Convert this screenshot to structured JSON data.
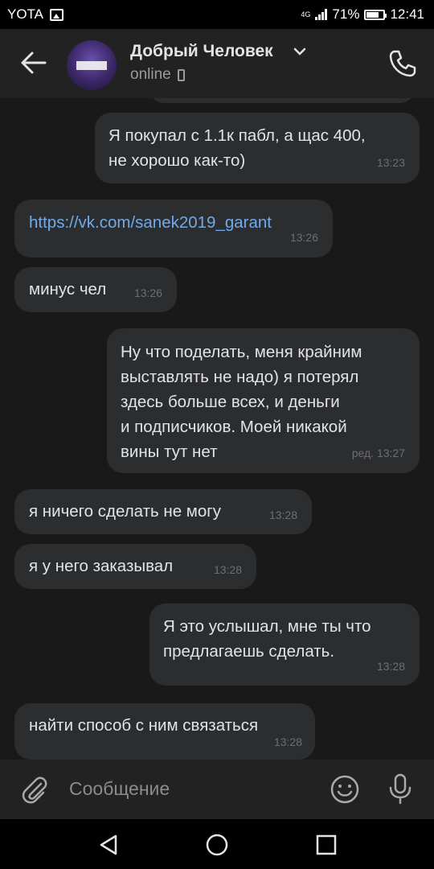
{
  "status_bar": {
    "carrier": "YOTA",
    "network": "4G",
    "battery": "71%",
    "time": "12:41"
  },
  "header": {
    "contact_name": "Добрый Человек",
    "presence": "online"
  },
  "messages": [
    {
      "direction": "out",
      "lines": [
        "Я покупал с 1.1к пабл, а щас 400,",
        "не хорошо как-то)"
      ],
      "time": "13:23"
    },
    {
      "direction": "in",
      "lines": [
        "https://vk.com/sanek2019_garant"
      ],
      "time": "13:26",
      "is_link": true
    },
    {
      "direction": "in",
      "lines": [
        "минус чел"
      ],
      "time": "13:26"
    },
    {
      "direction": "out",
      "lines": [
        "Ну что поделать, меня крайним",
        "выставлять не надо) я потерял",
        "здесь больше всех, и деньги",
        "и подписчиков. Моей никакой",
        "вины тут нет"
      ],
      "time": "ред. 13:27"
    },
    {
      "direction": "in",
      "lines": [
        "я ничего сделать не могу"
      ],
      "time": "13:28"
    },
    {
      "direction": "in",
      "lines": [
        "я у него заказывал"
      ],
      "time": "13:28"
    },
    {
      "direction": "out",
      "lines": [
        "Я это услышал, мне ты что",
        "предлагаешь сделать."
      ],
      "time": "13:28"
    },
    {
      "direction": "in",
      "lines": [
        "найти способ с ним связаться"
      ],
      "time": "13:28"
    }
  ],
  "composer": {
    "placeholder": "Сообщение"
  }
}
